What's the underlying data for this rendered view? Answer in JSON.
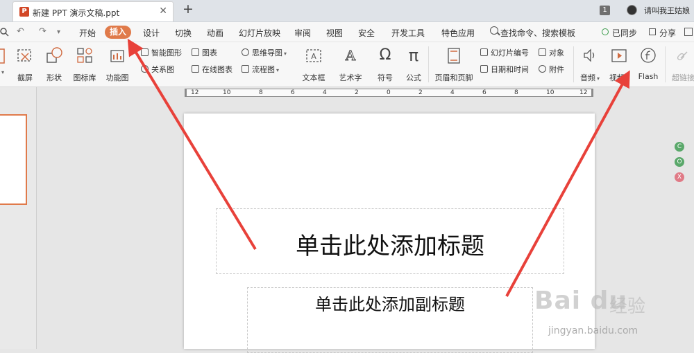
{
  "titlebar": {
    "app_icon": "P",
    "tab_title": "新建 PPT 演示文稿.ppt",
    "close_glyph": "✕",
    "new_tab_glyph": "+",
    "page_indicator": "1",
    "user_name": "请叫我王姑娘"
  },
  "menubar": {
    "undo_glyph": "↶",
    "redo_glyph": "↷",
    "dropdown_glyph": "▾",
    "items": [
      "开始",
      "插入",
      "设计",
      "切换",
      "动画",
      "幻灯片放映",
      "审阅",
      "视图",
      "安全",
      "开发工具",
      "特色应用"
    ],
    "active_item": "插入",
    "search_text": "查找命令、搜索模板",
    "sync_status": "已同步",
    "share_label": "分享"
  },
  "ribbon": {
    "large_buttons": [
      {
        "label": "截屏",
        "icon": "screenshot-icon"
      },
      {
        "label": "形状",
        "icon": "shapes-icon"
      },
      {
        "label": "图标库",
        "icon": "icon-library-icon"
      },
      {
        "label": "功能图",
        "icon": "function-chart-icon"
      },
      {
        "label": "文本框",
        "icon": "textbox-icon"
      },
      {
        "label": "艺术字",
        "icon": "wordart-icon"
      },
      {
        "label": "符号",
        "icon": "omega-icon"
      },
      {
        "label": "公式",
        "icon": "pi-icon"
      },
      {
        "label": "页眉和页脚",
        "icon": "header-footer-icon"
      },
      {
        "label": "音频",
        "icon": "audio-icon"
      },
      {
        "label": "视频",
        "icon": "video-icon"
      },
      {
        "label": "Flash",
        "icon": "flash-icon"
      },
      {
        "label": "超链接",
        "icon": "hyperlink-icon"
      }
    ],
    "small_buttons": [
      {
        "label": "智能图形",
        "icon": "smartart-icon"
      },
      {
        "label": "关系图",
        "icon": "relationship-icon"
      },
      {
        "label": "图表",
        "icon": "chart-icon"
      },
      {
        "label": "在线图表",
        "icon": "online-chart-icon"
      },
      {
        "label": "思维导图",
        "icon": "mindmap-icon"
      },
      {
        "label": "流程图",
        "icon": "flowchart-icon"
      },
      {
        "label": "幻灯片编号",
        "icon": "slide-number-icon"
      },
      {
        "label": "日期和时间",
        "icon": "datetime-icon"
      },
      {
        "label": "对象",
        "icon": "object-icon"
      },
      {
        "label": "附件",
        "icon": "attachment-icon"
      }
    ],
    "symbols": {
      "omega": "Ω",
      "pi": "π",
      "wordart": "A"
    }
  },
  "ruler": {
    "labels": [
      "12",
      "10",
      "8",
      "6",
      "4",
      "2",
      "0",
      "2",
      "4",
      "6",
      "8",
      "10",
      "12"
    ]
  },
  "slide": {
    "title_placeholder": "单击此处添加标题",
    "subtitle_placeholder": "单击此处添加副标题"
  },
  "float_tools": [
    "C",
    "O",
    "X"
  ],
  "watermark": {
    "logo": "Bai du",
    "sub": "经验",
    "url": "jingyan.baidu.com"
  },
  "colors": {
    "accent": "#e07a4a",
    "arrow": "#e8413a",
    "title_bar": "#dfe3e8",
    "ribbon_bg": "#f7f7f7"
  }
}
